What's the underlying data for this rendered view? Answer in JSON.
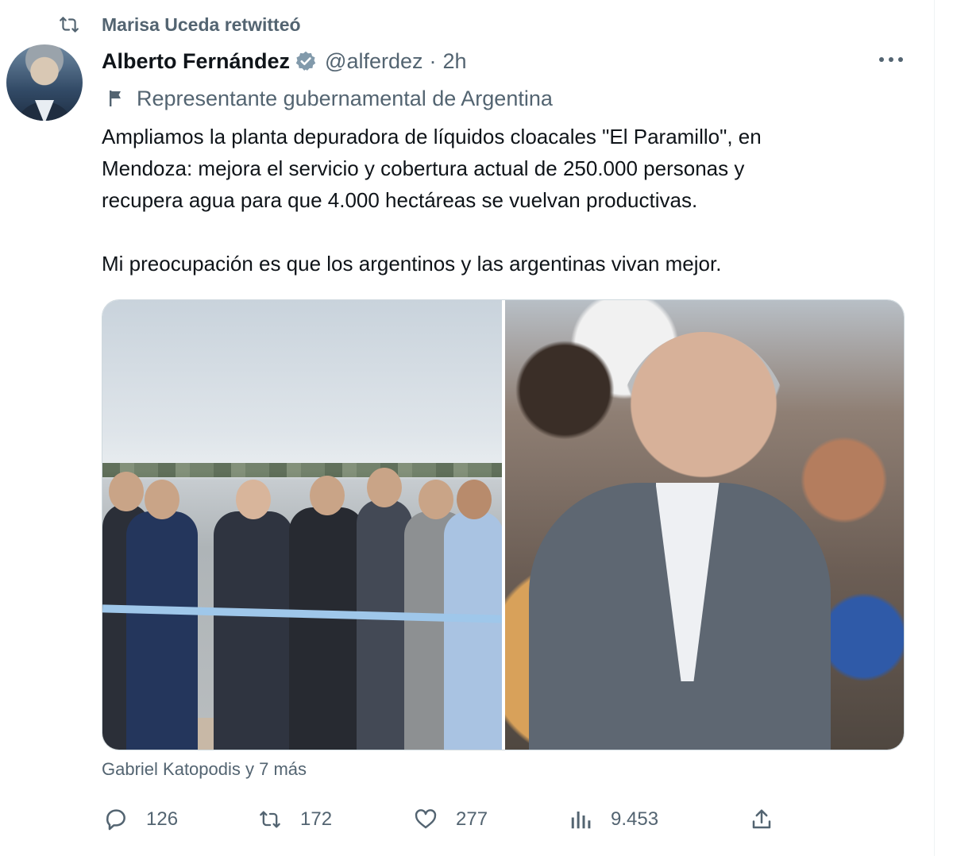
{
  "retweet": {
    "icon": "retweet-icon",
    "text": "Marisa Uceda retwitteó"
  },
  "author": {
    "name": "Alberto Fernández",
    "verified_icon": "verified-badge-icon",
    "handle": "@alferdez",
    "separator": "·",
    "time": "2h",
    "avatar": "avatar"
  },
  "label": {
    "icon": "flag-icon",
    "text": "Representante gubernamental de Argentina"
  },
  "tweet": {
    "lines": [
      "Ampliamos la planta depuradora de líquidos cloacales \"El Paramillo\", en",
      "Mendoza: mejora el servicio y cobertura actual de 250.000 personas y",
      "recupera agua para que 4.000 hectáreas se vuelvan productivas."
    ],
    "second_paragraph": "Mi preocupación es que los argentinos y las argentinas vivan mejor."
  },
  "media": {
    "photos": [
      "ribbon-cutting-photo",
      "crowd-photo"
    ]
  },
  "tagged": "Gabriel Katopodis y 7 más",
  "actions": {
    "reply": {
      "icon": "reply-icon",
      "count": "126"
    },
    "retweet": {
      "icon": "retweet-icon",
      "count": "172"
    },
    "like": {
      "icon": "heart-icon",
      "count": "277"
    },
    "views": {
      "icon": "analytics-icon",
      "count": "9.453"
    },
    "share": {
      "icon": "share-icon"
    }
  },
  "colors": {
    "text": "#0f1419",
    "secondary": "#536471",
    "verified": "#829aab",
    "border": "#cfd9de"
  }
}
